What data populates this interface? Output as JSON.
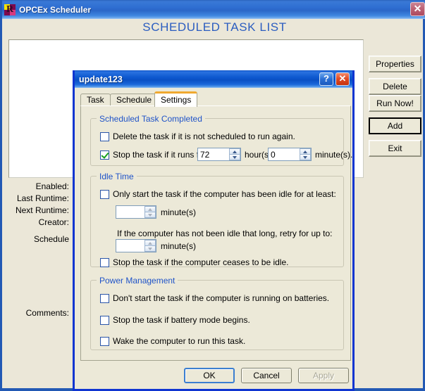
{
  "main_window": {
    "title": "OPCEx Scheduler",
    "icon": "app-logo-icon",
    "letter": "R",
    "close_glyph": "✕",
    "heading": "SCHEDULED TASK LIST"
  },
  "details": {
    "enabled": "Enabled:",
    "last_runtime": "Last Runtime:",
    "next_runtime": "Next Runtime:",
    "creator": "Creator:",
    "schedule": "Schedule",
    "comments": "Comments:"
  },
  "side_buttons": [
    {
      "label": "Properties",
      "accel": "P"
    },
    {
      "label": "Delete",
      "accel": "D"
    },
    {
      "label": "Run Now!",
      "accel": "R"
    },
    {
      "label": "Add",
      "accel": ""
    },
    {
      "label": "Exit",
      "accel": ""
    }
  ],
  "dialog": {
    "title": "update123",
    "help_glyph": "?",
    "close_glyph": "✕",
    "tabs": [
      {
        "label": "Task",
        "active": false
      },
      {
        "label": "Schedule",
        "active": false
      },
      {
        "label": "Settings",
        "active": true
      }
    ],
    "completed_group": {
      "title": "Scheduled Task Completed",
      "delete_checkbox": {
        "label": "Delete the task if it is not scheduled to run again.",
        "checked": false
      },
      "stop_checkbox": {
        "label": "Stop the task if it runs for:",
        "checked": true
      },
      "hours_value": "72",
      "hours_label": "hour(s)",
      "minutes_value": "0",
      "minutes_label": "minute(s)."
    },
    "idle_group": {
      "title": "Idle Time",
      "only_start_checkbox": {
        "label": "Only start the task if the computer has been idle for at least:",
        "checked": false
      },
      "idle_minutes_value": "",
      "idle_minutes_label": "minute(s)",
      "retry_text": "If the computer has not been idle that long, retry for up to:",
      "retry_minutes_value": "",
      "retry_minutes_label": "minute(s)",
      "stop_idle_checkbox": {
        "label": "Stop the task if the computer ceases to be idle.",
        "checked": false
      }
    },
    "power_group": {
      "title": "Power Management",
      "battery_checkbox": {
        "label": "Don't start the task if the computer is running on batteries.",
        "checked": false
      },
      "battery_mode_checkbox": {
        "label": "Stop the task if battery mode begins.",
        "checked": false
      },
      "wake_checkbox": {
        "label": "Wake the computer to run this task.",
        "checked": false
      }
    },
    "buttons": {
      "ok": "OK",
      "cancel": "Cancel",
      "apply": "Apply"
    }
  },
  "colors": {
    "window_face": "#ece9d8",
    "title_blue": "#0d58cf",
    "group_title": "#1f53c8",
    "heading_blue": "#2b5dc0",
    "active_tab_accent": "#f0a930",
    "check_green": "#17a01a"
  }
}
